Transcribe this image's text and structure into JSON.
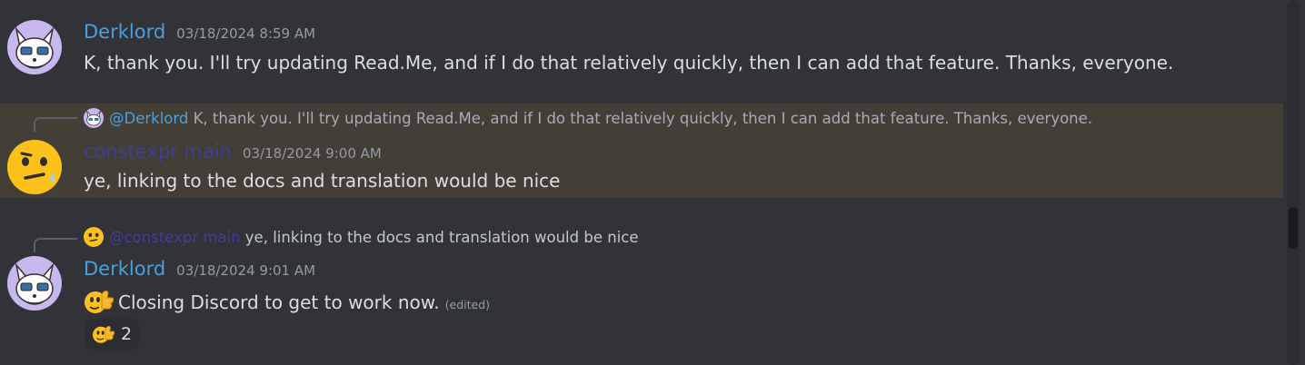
{
  "messages": [
    {
      "author": "Derklord",
      "timestamp": "03/18/2024 8:59 AM",
      "text": "K, thank you. I'll try updating Read.Me, and if I do that relatively quickly, then I can add that feature. Thanks, everyone."
    },
    {
      "reply": {
        "mention": "@Derklord",
        "text": "K, thank you. I'll try updating Read.Me, and if I do that relatively quickly, then I can add that feature. Thanks, everyone."
      },
      "author": "constexpr main",
      "timestamp": "03/18/2024 9:00 AM",
      "text": "ye, linking to the docs and translation would be nice"
    },
    {
      "reply": {
        "mention": "@constexpr main",
        "text": "ye, linking to the docs and translation would be nice"
      },
      "author": "Derklord",
      "timestamp": "03/18/2024 9:01 AM",
      "text": "Closing Discord to get to work now.",
      "edited": "(edited)",
      "reaction": {
        "emoji_icon": "thumbs-up-face-emoji",
        "count": "2"
      }
    }
  ],
  "colors": {
    "background": "#313338",
    "highlight": "#433f37",
    "username_blue": "#4ba0dc",
    "username_dark": "#3b3f9a"
  }
}
